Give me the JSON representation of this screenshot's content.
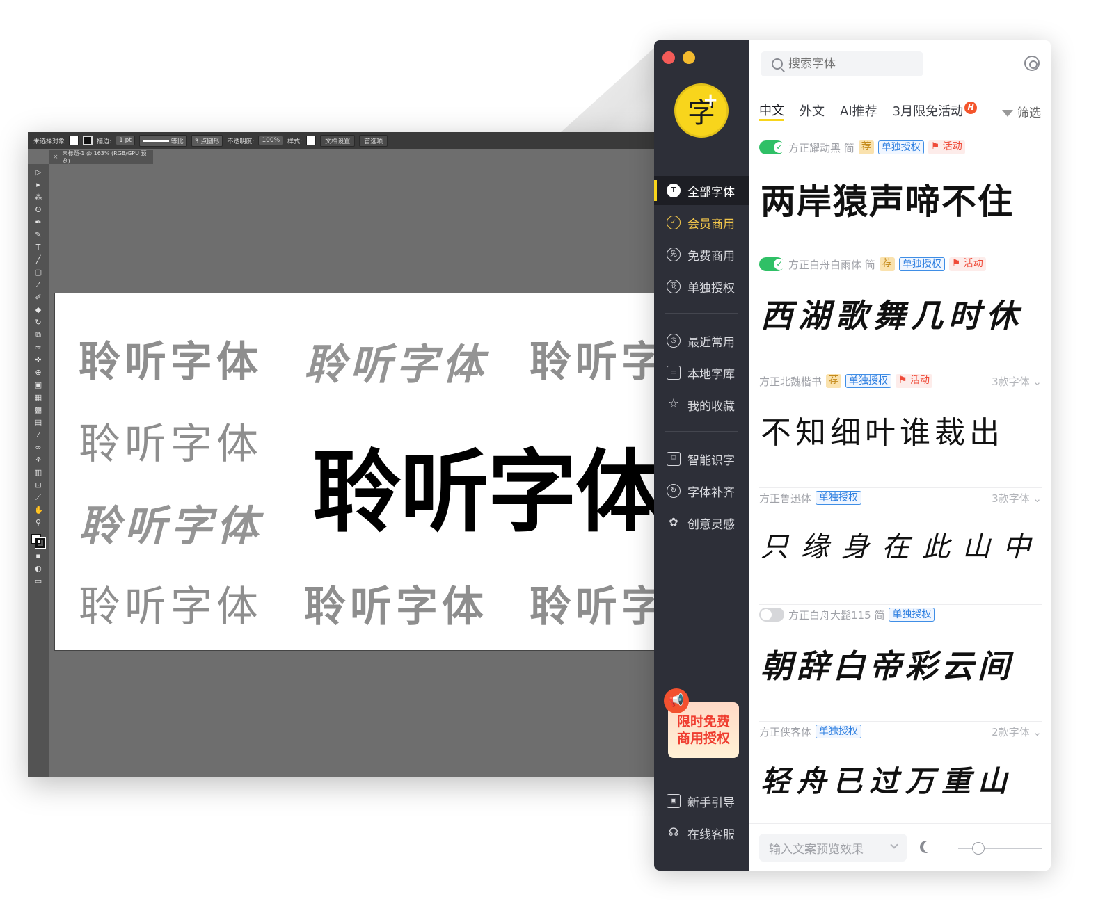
{
  "illustrator": {
    "control_bar": {
      "selection": "未选择对象",
      "stroke_label": "描边:",
      "stroke_value": "1 pt",
      "profile": "等比",
      "brush": "3 点圆形",
      "opacity_label": "不透明度:",
      "opacity_value": "100%",
      "style_label": "样式:",
      "doc_setup": "文档设置",
      "preferences": "首选项"
    },
    "doc_tab": "未标题-1 @ 163% (RGB/GPU 预览)",
    "artboard": {
      "sample_text": "聆听字体",
      "headline": "聆听字体",
      "partial_text": "聆听字"
    }
  },
  "app": {
    "colors": {
      "sidebar": "#2d2f38",
      "accent": "#f8d51c",
      "license_blue": "#2e7fe0",
      "activity_red": "#ef4a38",
      "toggle_green": "#2fc066"
    },
    "logo": {
      "char": "字",
      "plus": "+"
    },
    "sidebar": {
      "items": [
        {
          "label": "全部字体",
          "icon": "T"
        },
        {
          "label": "会员商用",
          "icon": "✓"
        },
        {
          "label": "免费商用",
          "icon": "免"
        },
        {
          "label": "单独授权",
          "icon": "商"
        },
        {
          "label": "最近常用",
          "icon": "◷"
        },
        {
          "label": "本地字库",
          "icon": "▭"
        },
        {
          "label": "我的收藏",
          "icon": "☆"
        },
        {
          "label": "智能识字",
          "icon": "⌸"
        },
        {
          "label": "字体补齐",
          "icon": "↻"
        },
        {
          "label": "创意灵感",
          "icon": "✿"
        }
      ],
      "promo": {
        "line1": "限时免费",
        "line2": "商用授权"
      },
      "footer": [
        {
          "label": "新手引导",
          "icon": "▣"
        },
        {
          "label": "在线客服",
          "icon": "☊"
        }
      ]
    },
    "search": {
      "placeholder": "搜索字体"
    },
    "tabs": [
      "中文",
      "外文",
      "AI推荐",
      "3月限免活动"
    ],
    "hot_badge": "H",
    "filter": "筛选",
    "fonts": [
      {
        "name": "方正耀动黑 简",
        "rec": "荐",
        "license": "单独授权",
        "activity": "活动",
        "variants": "",
        "preview": "两岸猿声啼不住"
      },
      {
        "name": "方正白舟白雨体 简",
        "rec": "荐",
        "license": "单独授权",
        "activity": "活动",
        "variants": "",
        "preview": "西湖歌舞几时休"
      },
      {
        "name": "方正北魏楷书",
        "rec": "荐",
        "license": "单独授权",
        "activity": "活动",
        "variants": "3款字体",
        "preview": "不知细叶谁裁出"
      },
      {
        "name": "方正鲁迅体",
        "rec": "",
        "license": "单独授权",
        "activity": "",
        "variants": "3款字体",
        "preview": "只缘身在此山中"
      },
      {
        "name": "方正白舟大髭115 简",
        "rec": "",
        "license": "单独授权",
        "activity": "",
        "variants": "",
        "preview": "朝辞白帝彩云间"
      },
      {
        "name": "方正侠客体",
        "rec": "",
        "license": "单独授权",
        "activity": "",
        "variants": "2款字体",
        "preview": "轻舟已过万重山"
      }
    ],
    "bottom": {
      "preview_placeholder": "输入文案预览效果"
    }
  }
}
